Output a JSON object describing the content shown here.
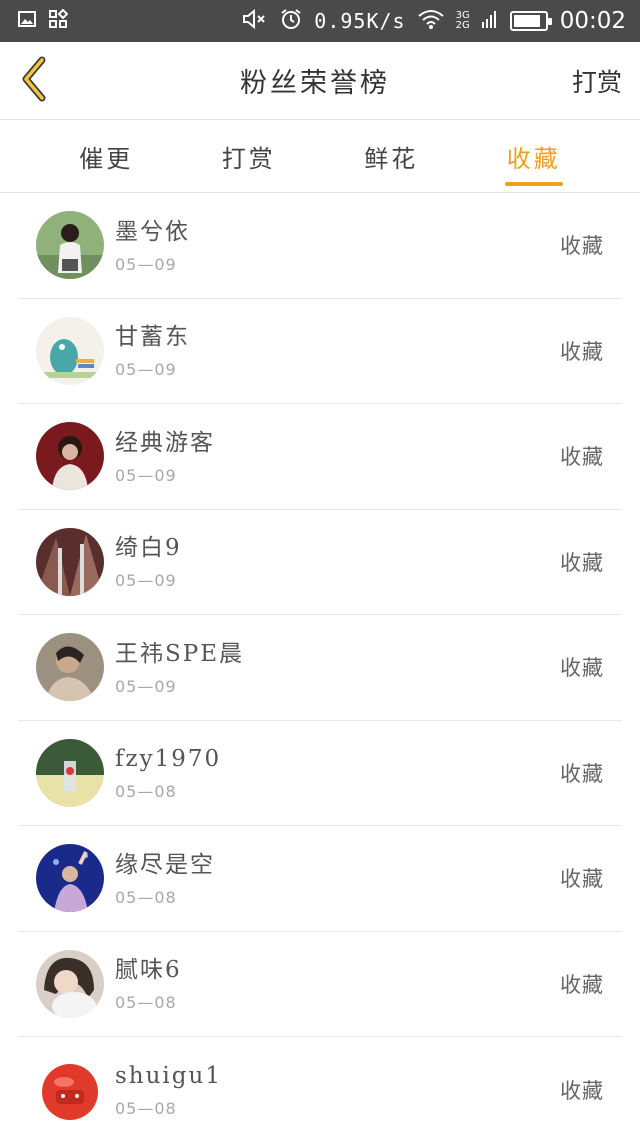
{
  "status_bar": {
    "speed": "0.95K/s",
    "network": [
      "3G",
      "2G"
    ],
    "time": "00:02",
    "icons": [
      "image-icon",
      "app-grid-icon",
      "mute-icon",
      "alarm-icon",
      "wifi-icon",
      "signal-icon",
      "battery-icon"
    ]
  },
  "header": {
    "title": "粉丝荣誉榜",
    "action_label": "打赏",
    "back_icon": "back-chevron-icon"
  },
  "tabs": [
    {
      "label": "催更",
      "active": false
    },
    {
      "label": "打赏",
      "active": false
    },
    {
      "label": "鲜花",
      "active": false
    },
    {
      "label": "收藏",
      "active": true
    }
  ],
  "colors": {
    "accent": "#f0a01c",
    "status_bar_bg": "#4a4a4a"
  },
  "fans": [
    {
      "name": "墨兮依",
      "date": "05—09",
      "action": "收藏"
    },
    {
      "name": "甘蓄东",
      "date": "05—09",
      "action": "收藏"
    },
    {
      "name": "经典游客",
      "date": "05—09",
      "action": "收藏"
    },
    {
      "name": "绮白9",
      "date": "05—09",
      "action": "收藏"
    },
    {
      "name": "王祎SPE晨",
      "date": "05—09",
      "action": "收藏"
    },
    {
      "name": "fzy1970",
      "date": "05—08",
      "action": "收藏"
    },
    {
      "name": "缘尽是空",
      "date": "05—08",
      "action": "收藏"
    },
    {
      "name": "腻味6",
      "date": "05—08",
      "action": "收藏"
    },
    {
      "name": "shuigu1",
      "date": "05—08",
      "action": "收藏"
    }
  ]
}
